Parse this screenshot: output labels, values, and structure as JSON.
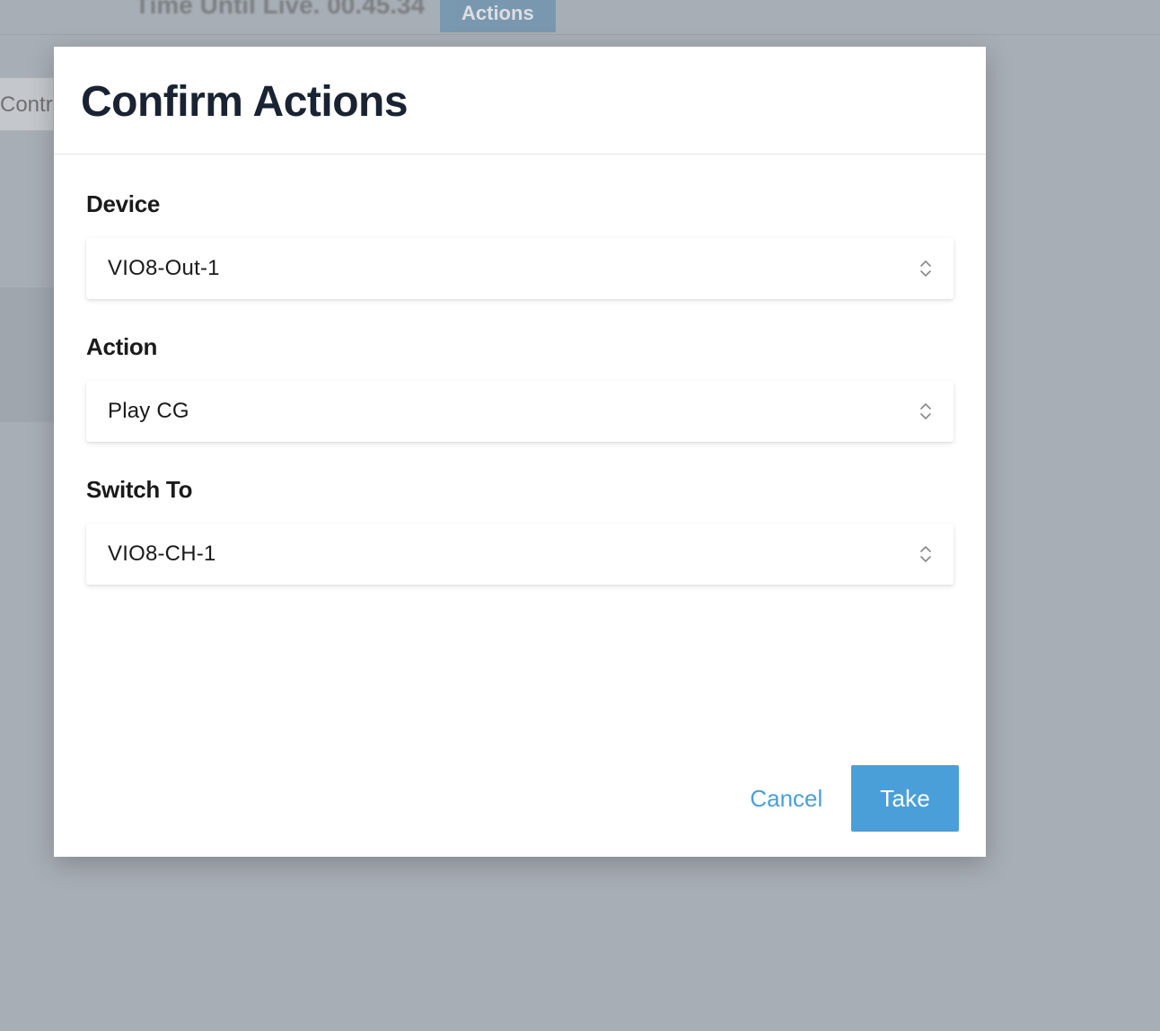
{
  "background": {
    "time_until_live_label": "Time Until Live. 00.45.34",
    "actions_button": "Actions",
    "contr_fragment": "Contr"
  },
  "modal": {
    "title": "Confirm Actions",
    "fields": {
      "device": {
        "label": "Device",
        "value": "VIO8-Out-1"
      },
      "action": {
        "label": "Action",
        "value": "Play CG"
      },
      "switch_to": {
        "label": "Switch To",
        "value": "VIO8-CH-1"
      }
    },
    "footer": {
      "cancel": "Cancel",
      "take": "Take"
    }
  },
  "colors": {
    "primary": "#4a9fd8",
    "text_dark": "#1a2332",
    "overlay": "#a8aeb5"
  }
}
